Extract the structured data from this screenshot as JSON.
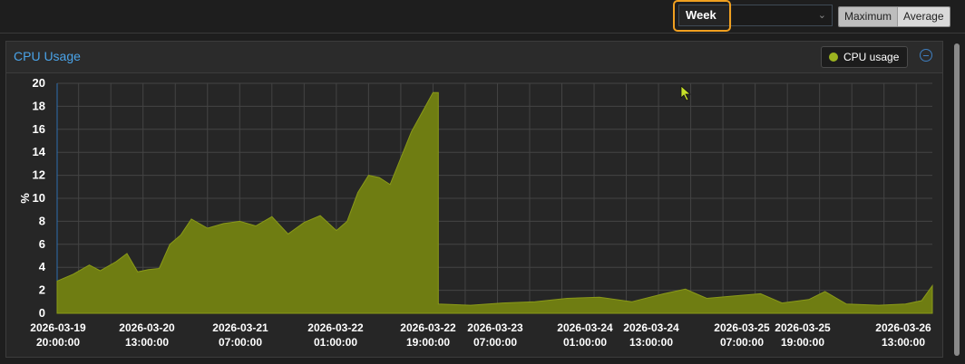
{
  "toolbar": {
    "timeframe": "Week",
    "consolidation": [
      "Maximum",
      "Average"
    ]
  },
  "panel": {
    "title": "CPU Usage",
    "legend_label": "CPU usage"
  },
  "colors": {
    "series": "#9cb320",
    "title": "#4aa3e8",
    "highlight": "#f0a020"
  },
  "chart_data": {
    "type": "area",
    "ylabel": "%",
    "ylim": [
      0,
      20
    ],
    "yticks": [
      0,
      2,
      4,
      6,
      8,
      10,
      12,
      14,
      16,
      18,
      20
    ],
    "xlim": [
      "2026-03-19 20:00",
      "2026-03-26 15:00"
    ],
    "xticks": [
      [
        "2026-03-19",
        "20:00:00"
      ],
      [
        "2026-03-20",
        "13:00:00"
      ],
      [
        "2026-03-21",
        "07:00:00"
      ],
      [
        "2026-03-22",
        "01:00:00"
      ],
      [
        "2026-03-22",
        "19:00:00"
      ],
      [
        "2026-03-23",
        "07:00:00"
      ],
      [
        "2026-03-24",
        "01:00:00"
      ],
      [
        "2026-03-24",
        "13:00:00"
      ],
      [
        "2026-03-25",
        "07:00:00"
      ],
      [
        "2026-03-25",
        "19:00:00"
      ],
      [
        "2026-03-26",
        "13:00:00"
      ]
    ],
    "grid": true,
    "series": [
      {
        "name": "CPU usage",
        "color": "#6f7d12",
        "points": [
          [
            "2026-03-19 20:00",
            2.8
          ],
          [
            "2026-03-19 23:00",
            3.4
          ],
          [
            "2026-03-20 02:00",
            4.2
          ],
          [
            "2026-03-20 04:00",
            3.7
          ],
          [
            "2026-03-20 07:00",
            4.5
          ],
          [
            "2026-03-20 09:00",
            5.2
          ],
          [
            "2026-03-20 11:00",
            3.6
          ],
          [
            "2026-03-20 13:00",
            3.8
          ],
          [
            "2026-03-20 15:00",
            3.9
          ],
          [
            "2026-03-20 17:00",
            6.0
          ],
          [
            "2026-03-20 19:00",
            6.8
          ],
          [
            "2026-03-20 21:00",
            8.2
          ],
          [
            "2026-03-21 00:00",
            7.4
          ],
          [
            "2026-03-21 03:00",
            7.8
          ],
          [
            "2026-03-21 06:00",
            8.0
          ],
          [
            "2026-03-21 09:00",
            7.6
          ],
          [
            "2026-03-21 12:00",
            8.4
          ],
          [
            "2026-03-21 15:00",
            6.9
          ],
          [
            "2026-03-21 18:00",
            7.9
          ],
          [
            "2026-03-21 21:00",
            8.5
          ],
          [
            "2026-03-22 00:00",
            7.2
          ],
          [
            "2026-03-22 02:00",
            8.0
          ],
          [
            "2026-03-22 04:00",
            10.5
          ],
          [
            "2026-03-22 06:00",
            12.0
          ],
          [
            "2026-03-22 08:00",
            11.8
          ],
          [
            "2026-03-22 10:00",
            11.2
          ],
          [
            "2026-03-22 12:00",
            13.5
          ],
          [
            "2026-03-22 14:00",
            15.8
          ],
          [
            "2026-03-22 16:00",
            17.5
          ],
          [
            "2026-03-22 18:00",
            19.2
          ],
          [
            "2026-03-22 19:00",
            0.8
          ],
          [
            "2026-03-23 01:00",
            0.7
          ],
          [
            "2026-03-23 07:00",
            0.9
          ],
          [
            "2026-03-23 13:00",
            1.0
          ],
          [
            "2026-03-23 19:00",
            1.3
          ],
          [
            "2026-03-24 01:00",
            1.4
          ],
          [
            "2026-03-24 07:00",
            1.0
          ],
          [
            "2026-03-24 13:00",
            1.7
          ],
          [
            "2026-03-24 17:00",
            2.1
          ],
          [
            "2026-03-24 21:00",
            1.3
          ],
          [
            "2026-03-25 02:00",
            1.5
          ],
          [
            "2026-03-25 07:00",
            1.7
          ],
          [
            "2026-03-25 11:00",
            0.9
          ],
          [
            "2026-03-25 16:00",
            1.2
          ],
          [
            "2026-03-25 19:00",
            1.9
          ],
          [
            "2026-03-25 23:00",
            0.8
          ],
          [
            "2026-03-26 05:00",
            0.7
          ],
          [
            "2026-03-26 10:00",
            0.8
          ],
          [
            "2026-03-26 13:00",
            1.1
          ],
          [
            "2026-03-26 15:00",
            2.4
          ]
        ]
      }
    ]
  }
}
